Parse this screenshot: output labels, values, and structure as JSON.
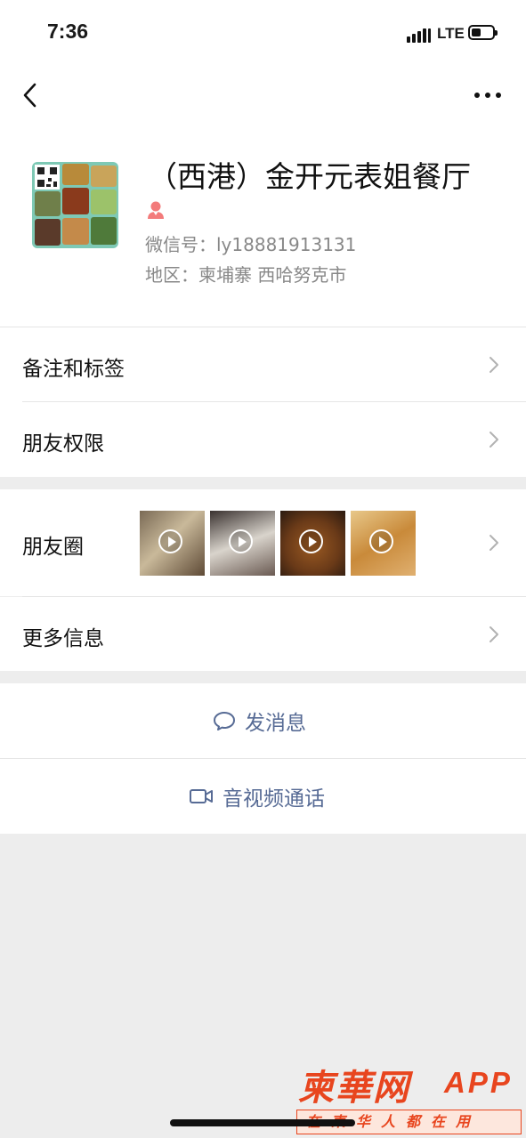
{
  "status_bar": {
    "time": "7:36",
    "network": "LTE",
    "signal_icon": "signal-bars-icon",
    "battery_icon": "battery-icon"
  },
  "nav": {
    "back_icon": "chevron-left-icon",
    "more_icon": "ellipsis-icon"
  },
  "profile": {
    "name": "（西港）金开元表姐餐厅",
    "gender_icon": "female-person-icon",
    "wechat_id": "微信号：ly18881913131",
    "region": "地区：柬埔寨 西哈努克市"
  },
  "menu": {
    "remarks_tags": "备注和标签",
    "friend_permissions": "朋友权限",
    "moments": "朋友圈",
    "more_info": "更多信息"
  },
  "actions": {
    "send_message": "发消息",
    "video_call": "音视频通话"
  },
  "colors": {
    "link_blue": "#576b95",
    "accent_red": "#e8451e",
    "gender_pink": "#f37b7b",
    "background": "#ededed"
  },
  "watermark": {
    "brand": "柬華网",
    "app": "APP",
    "slogan": "在柬华人都在用"
  }
}
